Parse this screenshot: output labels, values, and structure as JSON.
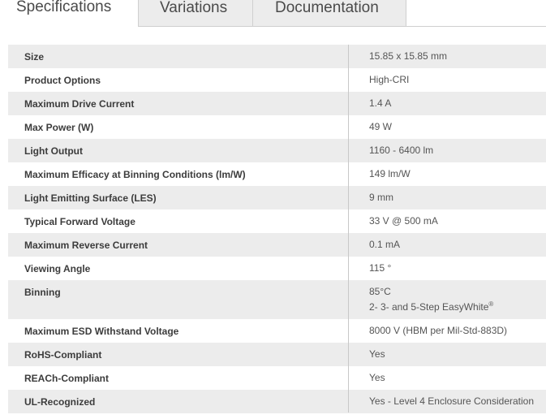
{
  "tabs": [
    {
      "label": "Specifications",
      "active": true
    },
    {
      "label": "Variations",
      "active": false
    },
    {
      "label": "Documentation",
      "active": false
    }
  ],
  "specs": [
    {
      "label": "Size",
      "value": "15.85 x 15.85 mm"
    },
    {
      "label": "Product Options",
      "value": "High-CRI"
    },
    {
      "label": "Maximum Drive Current",
      "value": "1.4 A"
    },
    {
      "label": "Max Power (W)",
      "value": "49 W"
    },
    {
      "label": "Light Output",
      "value": "1160 - 6400 lm"
    },
    {
      "label": "Maximum Efficacy at Binning Conditions (lm/W)",
      "value": "149 lm/W"
    },
    {
      "label": "Light Emitting Surface (LES)",
      "value": "9 mm"
    },
    {
      "label": "Typical Forward Voltage",
      "value": "33 V @ 500 mA"
    },
    {
      "label": "Maximum Reverse Current",
      "value": "0.1 mA"
    },
    {
      "label": "Viewing Angle",
      "value": "115 °"
    },
    {
      "label": "Binning",
      "value": "85°C",
      "value_line2": "2- 3- and 5-Step EasyWhite",
      "value_line2_sup": "®"
    },
    {
      "label": "Maximum ESD Withstand Voltage",
      "value": "8000 V (HBM per Mil-Std-883D)"
    },
    {
      "label": "RoHS-Compliant",
      "value": "Yes"
    },
    {
      "label": "REACh-Compliant",
      "value": "Yes"
    },
    {
      "label": "UL-Recognized",
      "value": "Yes - Level 4 Enclosure Consideration"
    }
  ],
  "colors": {
    "stripe": "#ececec",
    "divider": "#c8c8c8",
    "text": "#444444"
  }
}
